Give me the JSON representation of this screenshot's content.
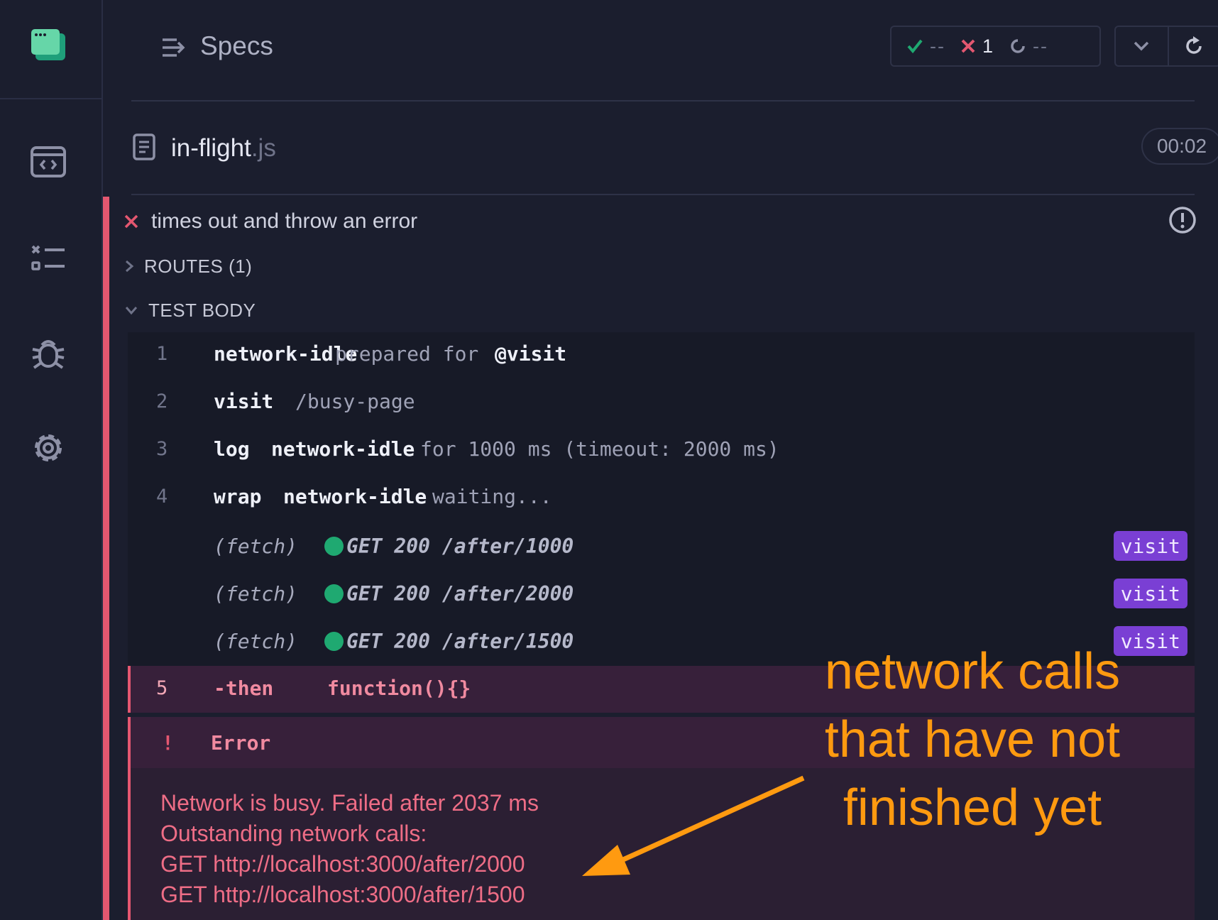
{
  "header": {
    "title": "Specs",
    "stats": {
      "passed": "--",
      "failed": "1",
      "pending": "--"
    }
  },
  "file": {
    "name": "in-flight",
    "ext": ".js",
    "duration": "00:02"
  },
  "test": {
    "title": "times out and throw an error",
    "routes_label": "ROUTES (1)",
    "body_label": "TEST BODY"
  },
  "commands": [
    {
      "num": "1",
      "name": "network-idle",
      "rest": "prepared for",
      "bold": "@visit"
    },
    {
      "num": "2",
      "name": "visit",
      "rest": "/busy-page"
    },
    {
      "num": "3",
      "name": "log",
      "bold": "network-idle",
      "rest": "for 1000 ms (timeout: 2000 ms)"
    },
    {
      "num": "4",
      "name": "wrap",
      "bold": "network-idle",
      "rest": "waiting..."
    }
  ],
  "fetches": [
    {
      "label": "(fetch)",
      "detail": "GET 200 /after/1000",
      "badge": "visit"
    },
    {
      "label": "(fetch)",
      "detail": "GET 200 /after/2000",
      "badge": "visit"
    },
    {
      "label": "(fetch)",
      "detail": "GET 200 /after/1500",
      "badge": "visit"
    }
  ],
  "failed_command": {
    "num": "5",
    "name": "-then",
    "rest": "function(){}"
  },
  "error": {
    "title": "Error",
    "lines": [
      "Network is busy. Failed after 2037 ms",
      "Outstanding network calls:",
      "GET http://localhost:3000/after/2000",
      "GET http://localhost:3000/after/1500"
    ]
  },
  "annotation": {
    "lines": [
      "network calls",
      "that have not",
      "finished yet"
    ],
    "color": "#ff9a10"
  },
  "colors": {
    "fail": "#e45770",
    "pass": "#1fa971",
    "badge": "#7a3fd4"
  }
}
